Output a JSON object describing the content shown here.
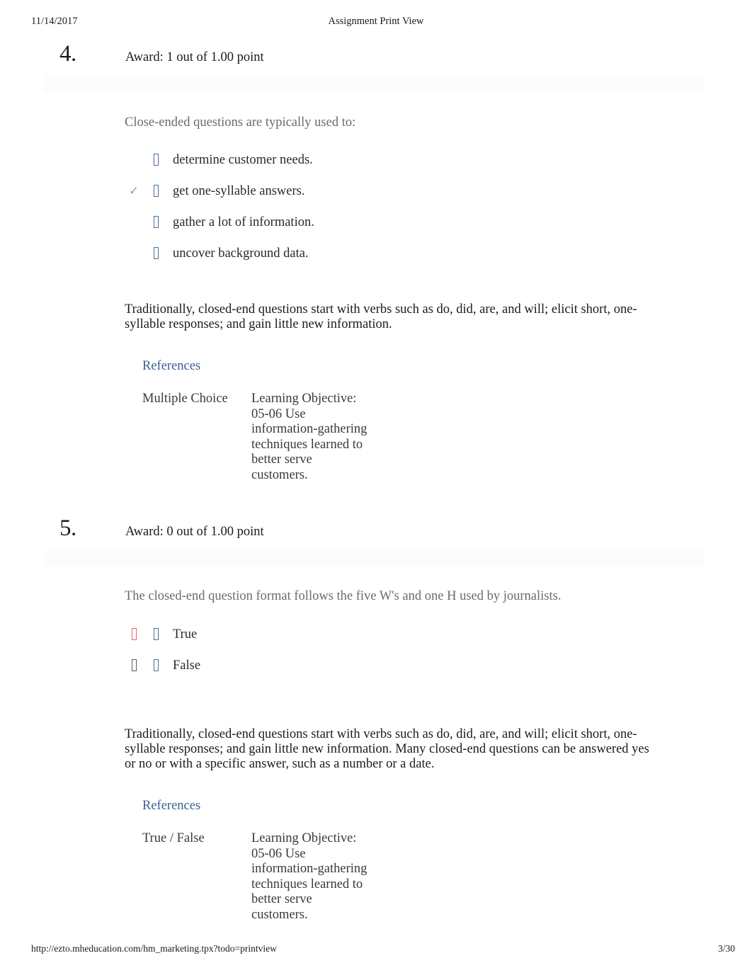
{
  "page": {
    "date": "11/14/2017",
    "title": "Assignment Print View",
    "footer_url": "http://ezto.mheducation.com/hm_marketing.tpx?todo=printview",
    "footer_page": "3/30"
  },
  "colors": {
    "link": "#3c6091",
    "stem_text": "#6b6b70",
    "radio_box": "#4c6f94",
    "incorrect_mark": "#e8626c",
    "divider_bar": "#fcfcfd"
  },
  "questions": [
    {
      "number": "4.",
      "award": "Award: 1 out of 1.00 point",
      "stem": "Close-ended questions are typically used to:",
      "options": [
        {
          "result": "",
          "result_kind": "none",
          "radio": "□",
          "label": "determine customer needs."
        },
        {
          "result": "✓",
          "result_kind": "correct",
          "radio": "□",
          "label": "get one-syllable answers."
        },
        {
          "result": "",
          "result_kind": "none",
          "radio": "□",
          "label": "gather a lot of information."
        },
        {
          "result": "",
          "result_kind": "none",
          "radio": "□",
          "label": "uncover background data."
        }
      ],
      "explanation": "Traditionally, closed-end questions start with verbs such as do, did, are, and will; elicit short, one-syllable responses; and gain little new information.",
      "references_label": "References",
      "meta_type": "Multiple Choice",
      "meta_objective": "Learning Objective: 05-06 Use information-gathering techniques learned to better serve customers."
    },
    {
      "number": "5.",
      "award": "Award: 0 out of 1.00 point",
      "stem": "The closed-end question format follows the five W's and one H used by journalists.",
      "options": [
        {
          "result": "✗",
          "result_kind": "incorrect",
          "radio": "□",
          "label": "True"
        },
        {
          "result": "□",
          "result_kind": "neutral",
          "radio": "□",
          "label": "False"
        }
      ],
      "explanation": "Traditionally, closed-end questions start with verbs such as do, did, are, and will; elicit short, one-syllable responses; and gain little new information. Many closed-end questions can be answered yes or no or with a specific answer, such as a number or a date.",
      "references_label": "References",
      "meta_type": "True / False",
      "meta_objective": "Learning Objective: 05-06 Use information-gathering techniques learned to better serve customers."
    }
  ]
}
